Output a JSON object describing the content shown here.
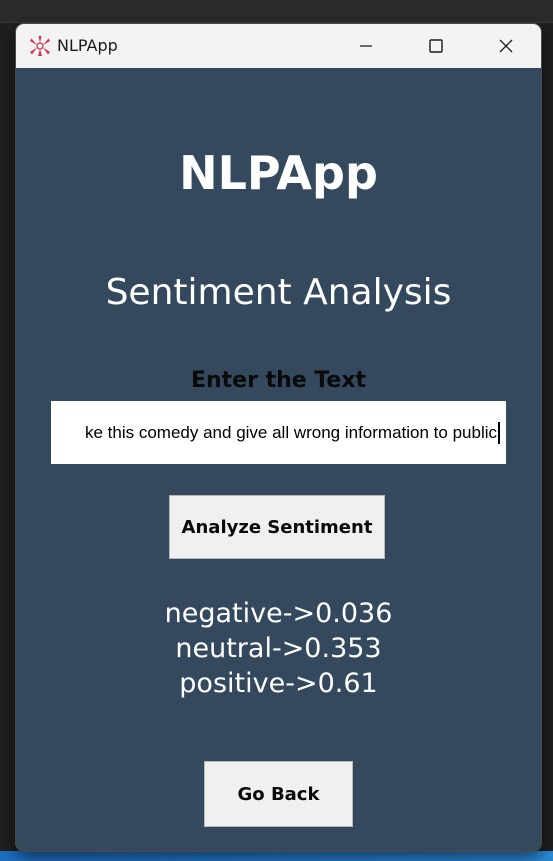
{
  "window": {
    "title": "NLPApp",
    "accent": "#d9304c",
    "background": "#34495e",
    "controls": [
      "minimize-icon",
      "maximize-icon",
      "close-icon"
    ]
  },
  "main": {
    "app_heading": "NLPApp",
    "page_title": "Sentiment Analysis",
    "input_label": "Enter the Text",
    "input_value": "ke this comedy and give all wrong information to public",
    "analyze_button": "Analyze Sentiment",
    "results": [
      "negative->0.036",
      "neutral->0.353",
      "positive->0.61"
    ],
    "back_button": "Go Back"
  }
}
